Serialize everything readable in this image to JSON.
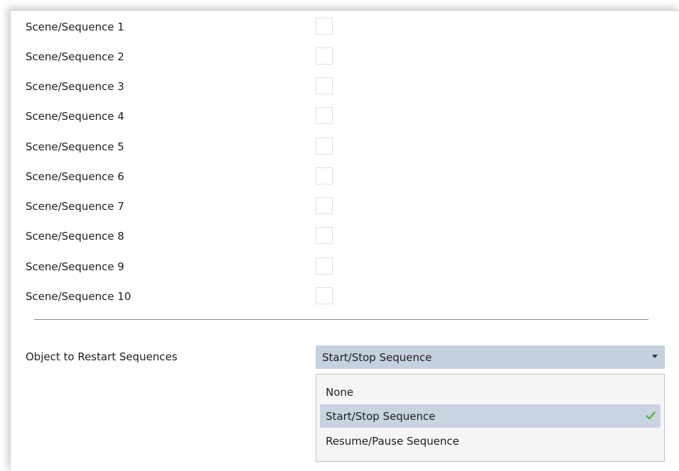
{
  "scene_list": {
    "items": [
      {
        "label": "Scene/Sequence 1",
        "checked": false
      },
      {
        "label": "Scene/Sequence 2",
        "checked": false
      },
      {
        "label": "Scene/Sequence 3",
        "checked": false
      },
      {
        "label": "Scene/Sequence 4",
        "checked": false
      },
      {
        "label": "Scene/Sequence 5",
        "checked": false
      },
      {
        "label": "Scene/Sequence 6",
        "checked": false
      },
      {
        "label": "Scene/Sequence 7",
        "checked": false
      },
      {
        "label": "Scene/Sequence 8",
        "checked": false
      },
      {
        "label": "Scene/Sequence 9",
        "checked": false
      },
      {
        "label": "Scene/Sequence 10",
        "checked": false
      }
    ]
  },
  "restart_object": {
    "label": "Object to Restart Sequences",
    "selected_value": "Start/Stop Sequence",
    "arrow_icon": "chevron-down-icon",
    "options": [
      {
        "label": "None",
        "selected": false
      },
      {
        "label": "Start/Stop Sequence",
        "selected": true
      },
      {
        "label": "Resume/Pause Sequence",
        "selected": false
      }
    ],
    "check_icon": "checkmark-icon"
  },
  "colors": {
    "combo_bg": "#c5d1df",
    "selected_option_bg": "#c9d4e1",
    "check_green": "#55a83a",
    "divider": "#8a8a8a"
  }
}
